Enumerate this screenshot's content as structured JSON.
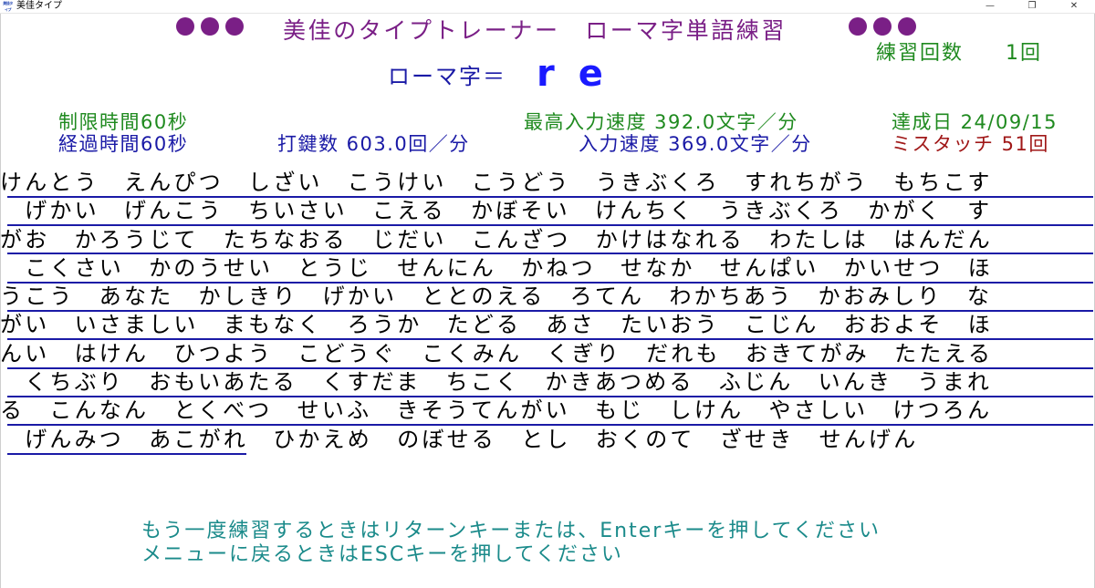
{
  "window": {
    "icon_text": "美佳タイプ",
    "title": "美佳タイプ",
    "minimize": "—",
    "maximize": "❐",
    "close": "✕"
  },
  "header": {
    "title": "美佳のタイプトレーナー　ローマ字単語練習",
    "practice_label": "練習回数",
    "practice_value": "1回",
    "romaji_label": "ローマ字＝",
    "romaji_value": "re"
  },
  "stats": {
    "time_limit": "制限時間60秒",
    "elapsed": "経過時間60秒",
    "keystrokes": "打鍵数 603.0回／分",
    "best_speed": "最高入力速度 392.0文字／分",
    "achieved_date": "達成日 24/09/15",
    "speed": "入力速度 369.0文字／分",
    "mistouch": "ミスタッチ 51回"
  },
  "colors": {
    "purple": "#7a1f86",
    "green": "#1f8a1f",
    "navy": "#1a1aa6",
    "blue": "#1a1aff",
    "red": "#a01818",
    "teal": "#1a8a8a"
  },
  "word_lines": [
    "けんとう　えんぴつ　しざい　こうけい　こうどう　うきぶくろ　すれちがう　もちこす",
    "　げかい　げんこう　ちいさい　こえる　かぼそい　けんちく　うきぶくろ　かがく　す",
    "がお　かろうじて　たちなおる　じだい　こんざつ　かけはなれる　わたしは　はんだん",
    "　こくさい　かのうせい　とうじ　せんにん　かねつ　せなか　せんぱい　かいせつ　ほ",
    "うこう　あなた　かしきり　げかい　ととのえる　ろてん　わかちあう　かおみしり　な",
    "がい　いさましい　まもなく　ろうか　たどる　あさ　たいおう　こじん　おおよそ　ほ",
    "んい　はけん　ひつよう　こどうぐ　こくみん　くぎり　だれも　おきてがみ　たたえる",
    "　くちぶり　おもいあたる　くすだま　ちこく　かきあつめる　ふじん　いんき　うまれ",
    "る　こんなん　とくべつ　せいふ　きそうてんがい　もじ　しけん　やさしい　けつろん",
    "　げんみつ　あこがれ　ひかえめ　のぼせる　とし　おくのて　ざせき　せんげん"
  ],
  "typed_progress": {
    "full_lines": 9,
    "last_line_fraction": 0.22
  },
  "footer": {
    "line1": "もう一度練習するときはリターンキーまたは、Enterキーを押してください",
    "line2": "メニューに戻るときはESCキーを押してください"
  }
}
